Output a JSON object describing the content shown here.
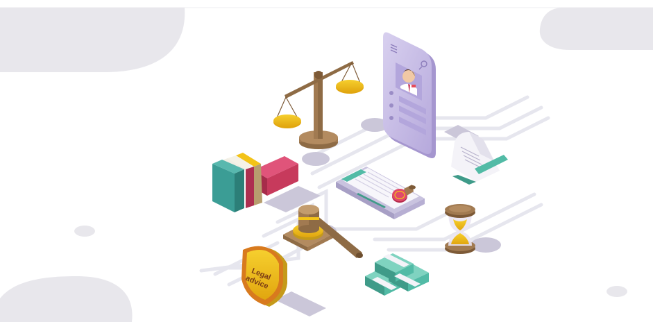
{
  "illustration": {
    "shield_text": "Legal\nadvice",
    "stamp_text": "",
    "colors": {
      "background": "#ffffff",
      "blob": "#e8e7ec",
      "circuit": "#e6e6ee",
      "shadow": "#cbc7d9",
      "gold": "#f3c318",
      "wood": "#a17a51",
      "wood_dark": "#7d5a37",
      "phone": "#c9bfe6",
      "book_teal": "#3b9d95",
      "book_red": "#c73a5c",
      "cash": "#52bba6"
    }
  }
}
